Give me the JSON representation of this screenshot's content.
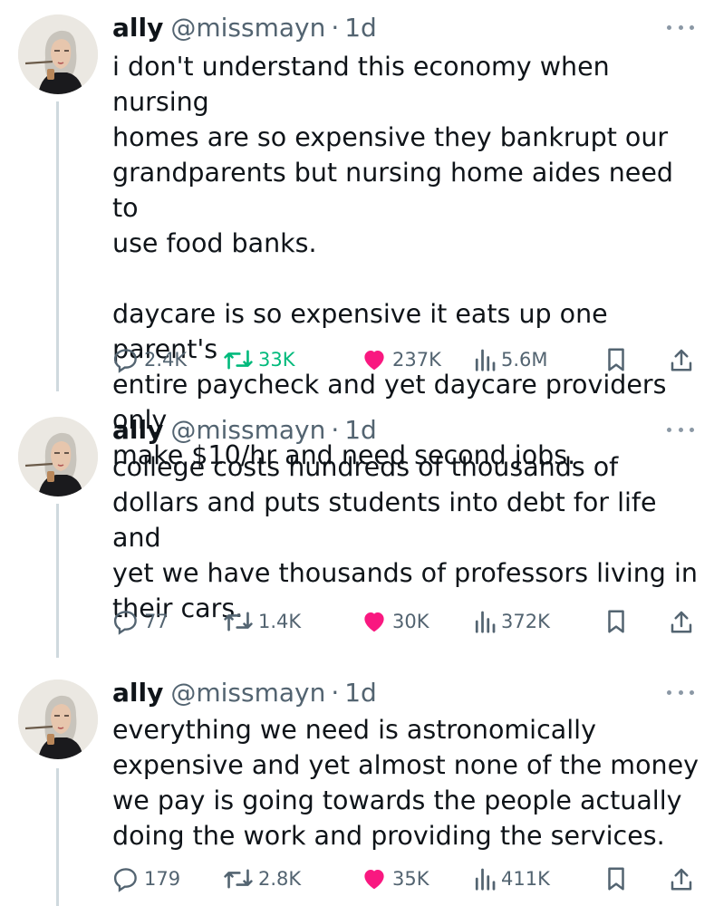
{
  "colors": {
    "text": "#0f1419",
    "secondary": "#536471",
    "like_pink": "#f91880",
    "retweet_green": "#00ba7c",
    "thread_line": "#cfd9de"
  },
  "tweets": [
    {
      "author": {
        "name": "ally",
        "handle": "@missmayn",
        "separator": "·",
        "time": "1d",
        "avatar": "avatar-photo"
      },
      "text": "i don't understand this economy when nursing\nhomes are so expensive they bankrupt our\ngrandparents but nursing home aides need to\nuse food banks.\n\ndaycare is so expensive it eats up one parent's\nentire paycheck and yet daycare providers only\nmake $10/hr and need second jobs.",
      "stats": {
        "replies": "2.4K",
        "retweets": "33K",
        "likes": "237K",
        "views": "5.6M"
      },
      "state": {
        "liked": true,
        "retweeted": true
      },
      "icons": {
        "reply": "reply-icon",
        "retweet": "retweet-icon",
        "like": "heart-icon",
        "views": "views-icon",
        "bookmark": "bookmark-icon",
        "share": "share-icon",
        "more": "more-icon"
      }
    },
    {
      "author": {
        "name": "ally",
        "handle": "@missmayn",
        "separator": "·",
        "time": "1d",
        "avatar": "avatar-photo"
      },
      "text": "college costs hundreds of thousands of\ndollars and puts students into debt for life and\nyet we have thousands of professors living in\ntheir cars.",
      "stats": {
        "replies": "77",
        "retweets": "1.4K",
        "likes": "30K",
        "views": "372K"
      },
      "state": {
        "liked": true,
        "retweeted": false
      },
      "icons": {
        "reply": "reply-icon",
        "retweet": "retweet-icon",
        "like": "heart-icon",
        "views": "views-icon",
        "bookmark": "bookmark-icon",
        "share": "share-icon",
        "more": "more-icon"
      }
    },
    {
      "author": {
        "name": "ally",
        "handle": "@missmayn",
        "separator": "·",
        "time": "1d",
        "avatar": "avatar-photo"
      },
      "text": "everything we need is astronomically\nexpensive and yet almost none of the money\nwe pay is going towards the people actually\ndoing the work and providing the services.",
      "stats": {
        "replies": "179",
        "retweets": "2.8K",
        "likes": "35K",
        "views": "411K"
      },
      "state": {
        "liked": true,
        "retweeted": false
      },
      "icons": {
        "reply": "reply-icon",
        "retweet": "retweet-icon",
        "like": "heart-icon",
        "views": "views-icon",
        "bookmark": "bookmark-icon",
        "share": "share-icon",
        "more": "more-icon"
      }
    }
  ]
}
